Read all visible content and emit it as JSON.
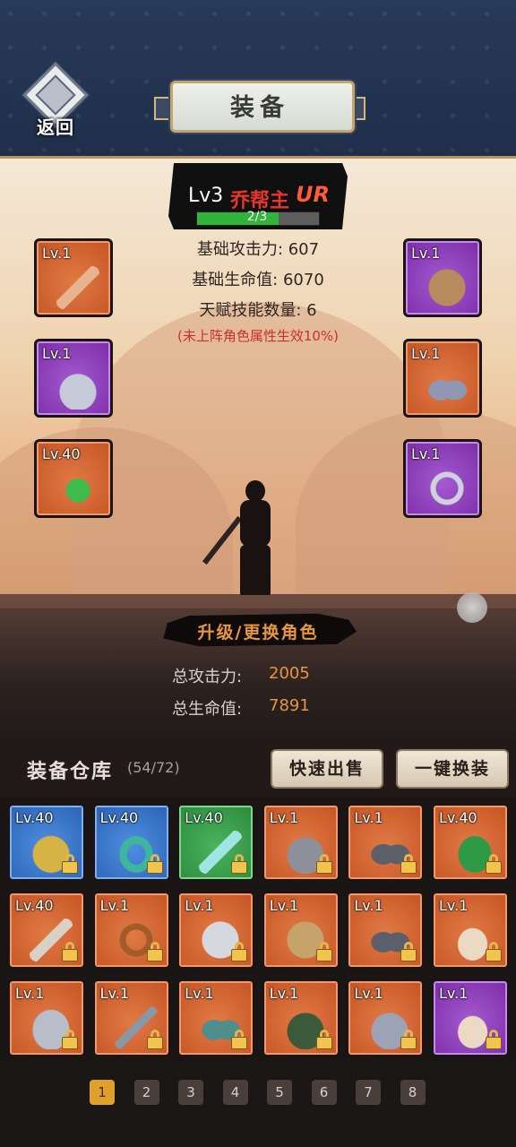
{
  "header": {
    "back_label": "返回",
    "title": "装备"
  },
  "character": {
    "level": "Lv3",
    "name": "乔帮主",
    "rarity": "UR",
    "exp_text": "2/3",
    "exp_progress": 0.67,
    "stats": {
      "base_attack": "基础攻击力: 607",
      "base_hp": "基础生命值: 6070",
      "talent_count": "天赋技能数量: 6"
    },
    "note": "(未上阵角色属性生效10%)"
  },
  "equipped": {
    "left": [
      {
        "level": "Lv.1",
        "rarity": "orange",
        "icon": "sword-icon"
      },
      {
        "level": "Lv.1",
        "rarity": "purple",
        "icon": "helmet-icon"
      },
      {
        "level": "Lv.40",
        "rarity": "orange",
        "icon": "amulet-icon"
      }
    ],
    "right": [
      {
        "level": "Lv.1",
        "rarity": "purple",
        "icon": "armor-icon"
      },
      {
        "level": "Lv.1",
        "rarity": "orange",
        "icon": "boots-icon"
      },
      {
        "level": "Lv.1",
        "rarity": "purple",
        "icon": "ring-icon"
      }
    ]
  },
  "upgrade_button": "升级/更换角色",
  "totals": {
    "attack_label": "总攻击力:",
    "attack_value": "2005",
    "hp_label": "总生命值:",
    "hp_value": "7891"
  },
  "warehouse": {
    "title": "装备仓库",
    "count": "(54/72)",
    "quick_sell": "快速出售",
    "auto_equip": "一键换装",
    "items": [
      {
        "level": "Lv.40",
        "rarity": "blue",
        "icon": "gold-helmet-icon",
        "locked": true
      },
      {
        "level": "Lv.40",
        "rarity": "blue",
        "icon": "jade-bracelet-icon",
        "locked": true
      },
      {
        "level": "Lv.40",
        "rarity": "green",
        "icon": "jade-sword-icon",
        "locked": true
      },
      {
        "level": "Lv.1",
        "rarity": "orange",
        "icon": "horned-helmet-icon",
        "locked": true
      },
      {
        "level": "Lv.1",
        "rarity": "orange",
        "icon": "steel-boots-icon",
        "locked": true
      },
      {
        "level": "Lv.40",
        "rarity": "orange",
        "icon": "green-boots-icon",
        "locked": true
      },
      {
        "level": "Lv.40",
        "rarity": "orange",
        "icon": "sword-icon",
        "locked": true
      },
      {
        "level": "Lv.1",
        "rarity": "orange",
        "icon": "bronze-bracelet-icon",
        "locked": true
      },
      {
        "level": "Lv.1",
        "rarity": "orange",
        "icon": "plate-armor-icon",
        "locked": true
      },
      {
        "level": "Lv.1",
        "rarity": "orange",
        "icon": "leather-armor-icon",
        "locked": true
      },
      {
        "level": "Lv.1",
        "rarity": "orange",
        "icon": "steel-boots-icon",
        "locked": true
      },
      {
        "level": "Lv.1",
        "rarity": "orange",
        "icon": "shell-pendant-icon",
        "locked": true
      },
      {
        "level": "Lv.1",
        "rarity": "orange",
        "icon": "chain-armor-icon",
        "locked": true
      },
      {
        "level": "Lv.1",
        "rarity": "orange",
        "icon": "spear-pendant-icon",
        "locked": true
      },
      {
        "level": "Lv.1",
        "rarity": "orange",
        "icon": "teal-boots-icon",
        "locked": true
      },
      {
        "level": "Lv.1",
        "rarity": "orange",
        "icon": "dark-helmet-icon",
        "locked": true
      },
      {
        "level": "Lv.1",
        "rarity": "orange",
        "icon": "silver-helmet-icon",
        "locked": true
      },
      {
        "level": "Lv.1",
        "rarity": "purple",
        "icon": "shell-pendant-icon",
        "locked": true
      }
    ]
  },
  "pagination": {
    "pages": [
      "1",
      "2",
      "3",
      "4",
      "5",
      "6",
      "7",
      "8"
    ],
    "active": "1"
  }
}
